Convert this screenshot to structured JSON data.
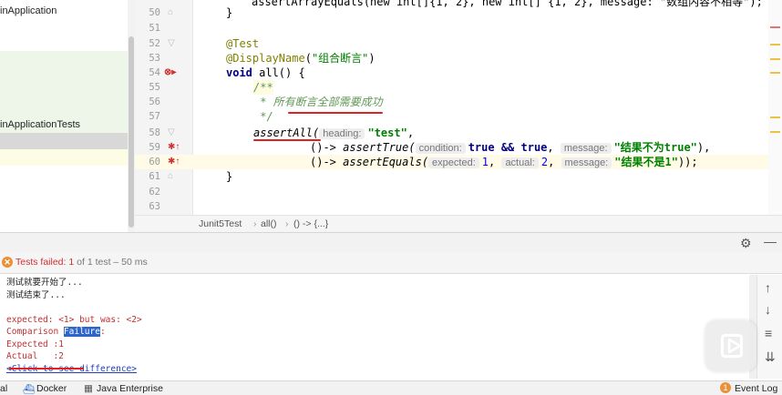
{
  "project": {
    "items": [
      "inApplication",
      "inApplicationTests"
    ]
  },
  "editor": {
    "line_numbers": [
      "50",
      "51",
      "52",
      "53",
      "54",
      "55",
      "56",
      "57",
      "58",
      "59",
      "60",
      "61",
      "62",
      "63"
    ],
    "line50": "assertArrayEquals(new int[]{1, 2}, new int[] {1, 2}, message: \"数组内容不相等\");",
    "line50_brace": "}",
    "line52_annotation": "@Test",
    "line53_annotation": "@DisplayName",
    "line53_arg": "\"组合断言\"",
    "line54_kw": "void",
    "line54_rest": " all() {",
    "line55": "/**",
    "line56": " * 所有断言全部需要成功",
    "line57": " */",
    "line58_method": "assertAll(",
    "line58_hint": "heading:",
    "line58_str": "\"test\"",
    "line59_lambda": "()-> ",
    "line59_method": "assertTrue(",
    "line59_hint1": "condition:",
    "line59_cond": "true && true",
    "line59_hint2": "message:",
    "line59_msg": "\"结果不为true\"",
    "line60_lambda": "()-> ",
    "line60_method": "assertEquals(",
    "line60_hint1": "expected:",
    "line60_v1": "1",
    "line60_hint2": "actual:",
    "line60_v2": "2",
    "line60_hint3": "message:",
    "line60_msg": "\"结果不是1\"",
    "line60_end": "));",
    "line61": "}"
  },
  "breadcrumb": {
    "class": "Junit5Test",
    "method": "all()",
    "lambda": "() -> {...}"
  },
  "run": {
    "status_prefix": "Tests failed:",
    "failed_count": "1",
    "status_suffix": "of 1 test – 50 ms",
    "console": {
      "line1": "测试就要开始了...",
      "line2": "测试结束了...",
      "line3": "expected: <1> but was: <2>",
      "line4_prefix": "Comparison ",
      "line4_highlight": "Failure",
      "line4_suffix": ":",
      "line5": "Expected :1",
      "line6": "Actual   :2",
      "line7": "<Click to see difference>"
    }
  },
  "statusbar": {
    "item0": "al",
    "item1": "Docker",
    "item2": "Java Enterprise",
    "event_count": "1",
    "event_log": "Event Log"
  },
  "colors": {
    "accent_red": "#e02020",
    "keyword": "#000080",
    "string": "#008000",
    "annotation": "#808000",
    "doc_comment": "#629755"
  }
}
